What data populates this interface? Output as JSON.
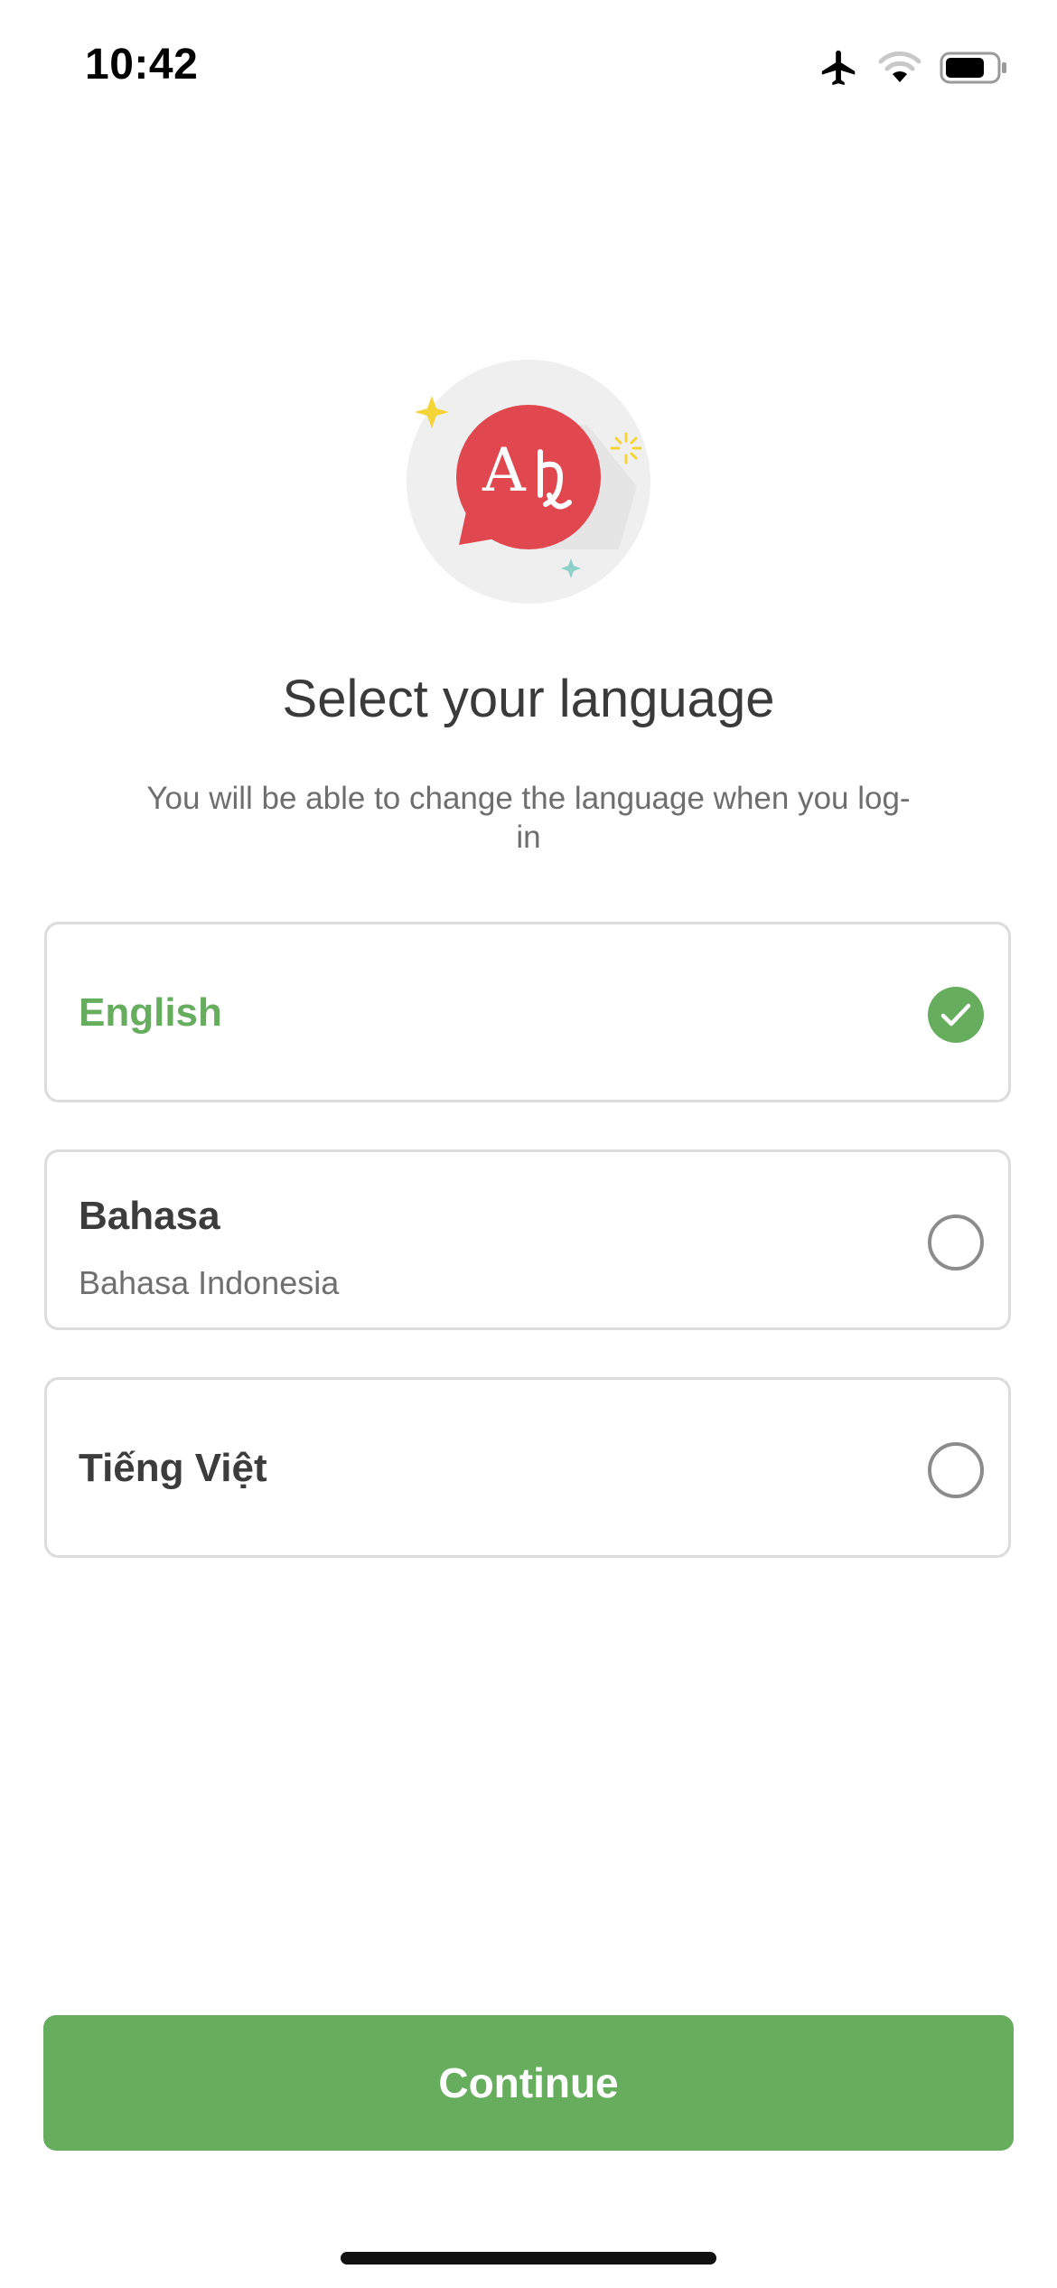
{
  "status_bar": {
    "time": "10:42",
    "icons": [
      "airplane-icon",
      "wifi-icon",
      "battery-icon"
    ]
  },
  "hero": {
    "icon": "translate-bubble-icon",
    "glyph": "A",
    "colors": {
      "circle_bg": "#efefef",
      "bubble": "#e0474f",
      "sparkle_yellow": "#f5d43a",
      "sparkle_teal": "#8fd0c9"
    }
  },
  "title": "Select your language",
  "subtitle": "You will be able to change the language when you log-in",
  "languages": [
    {
      "label": "English",
      "native": "",
      "selected": true
    },
    {
      "label": "Bahasa",
      "native": "Bahasa Indonesia",
      "selected": false
    },
    {
      "label": "Tiếng Việt",
      "native": "",
      "selected": false
    }
  ],
  "continue_label": "Continue",
  "colors": {
    "accent": "#66ad5e",
    "card_border": "#dcdcdc",
    "text_primary": "#3c3c3c",
    "text_secondary": "#6e6e6e"
  }
}
